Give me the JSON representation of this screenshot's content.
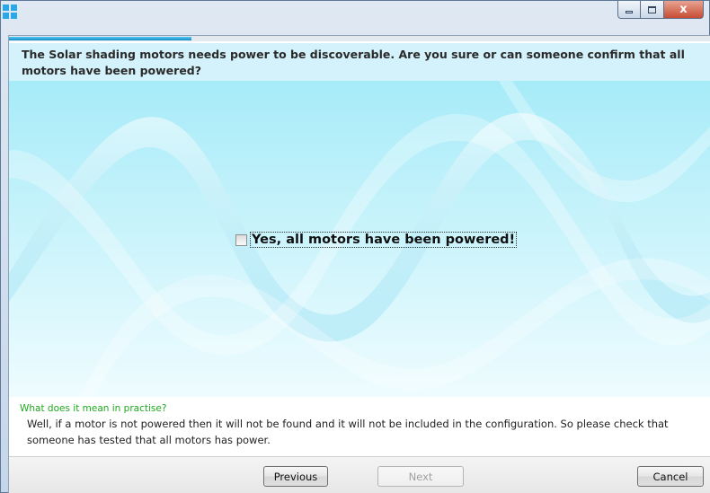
{
  "window": {
    "icon": "windows-logo-icon",
    "controls": {
      "minimize": "minimize-icon",
      "maximize": "maximize-icon",
      "close_label": "x"
    }
  },
  "progress": {
    "fraction": 0.26,
    "color": "#118bc6"
  },
  "question": {
    "text": "The Solar shading motors needs power to be discoverable. Are you sure or can someone confirm that all motors have been powered?"
  },
  "confirm": {
    "label": "Yes, all motors have been powered!",
    "checked": false
  },
  "help": {
    "title": "What does it mean in practise?",
    "text": "Well, if a motor is not powered then it will not be found and it will not be included in the configuration. So please check that someone has tested that all motors has power.",
    "title_color": "#1fa81f"
  },
  "buttons": {
    "previous": "Previous",
    "next": "Next",
    "cancel": "Cancel"
  },
  "colors": {
    "question_bg": "#d4f2fb",
    "stage_top": "#a6ebf8",
    "accent": "#2aa7e6"
  }
}
